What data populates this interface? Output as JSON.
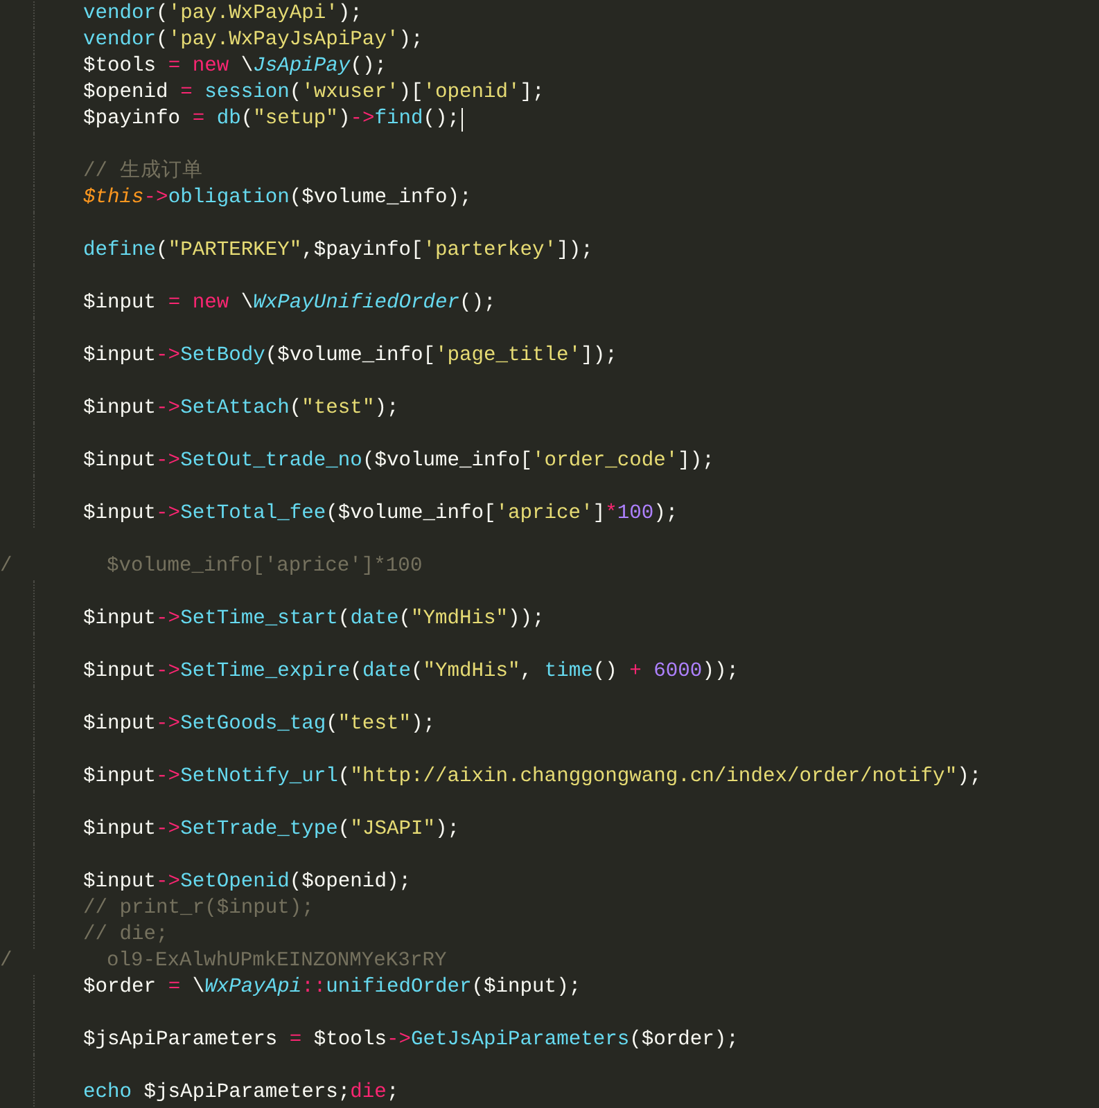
{
  "editor": {
    "lines": [
      {
        "kind": "code",
        "blank_before": false,
        "tokens": [
          {
            "kind": "fn",
            "text": "vendor"
          },
          {
            "kind": "plain",
            "text": "("
          },
          {
            "kind": "str",
            "text": "'pay.WxPayApi'"
          },
          {
            "kind": "plain",
            "text": ");"
          }
        ]
      },
      {
        "kind": "code",
        "blank_before": false,
        "tokens": [
          {
            "kind": "fn",
            "text": "vendor"
          },
          {
            "kind": "plain",
            "text": "("
          },
          {
            "kind": "str",
            "text": "'pay.WxPayJsApiPay'"
          },
          {
            "kind": "plain",
            "text": ");"
          }
        ]
      },
      {
        "kind": "code",
        "blank_before": false,
        "tokens": [
          {
            "kind": "plain",
            "text": "$tools "
          },
          {
            "kind": "kw",
            "text": "= new"
          },
          {
            "kind": "plain",
            "text": " \\"
          },
          {
            "kind": "cls",
            "text": "JsApiPay"
          },
          {
            "kind": "plain",
            "text": "();"
          }
        ]
      },
      {
        "kind": "code",
        "blank_before": false,
        "tokens": [
          {
            "kind": "plain",
            "text": "$openid "
          },
          {
            "kind": "kw",
            "text": "="
          },
          {
            "kind": "fn",
            "text": " session"
          },
          {
            "kind": "plain",
            "text": "("
          },
          {
            "kind": "str",
            "text": "'wxuser'"
          },
          {
            "kind": "plain",
            "text": ")["
          },
          {
            "kind": "str",
            "text": "'openid'"
          },
          {
            "kind": "plain",
            "text": "];"
          }
        ]
      },
      {
        "kind": "code",
        "blank_before": false,
        "cursor": true,
        "tokens": [
          {
            "kind": "plain",
            "text": "$payinfo "
          },
          {
            "kind": "kw",
            "text": "="
          },
          {
            "kind": "fn",
            "text": " db"
          },
          {
            "kind": "plain",
            "text": "("
          },
          {
            "kind": "str",
            "text": "\"setup\""
          },
          {
            "kind": "plain",
            "text": ")"
          },
          {
            "kind": "kw",
            "text": "->"
          },
          {
            "kind": "fn",
            "text": "find"
          },
          {
            "kind": "plain",
            "text": "();"
          }
        ]
      },
      {
        "kind": "code",
        "blank_before": true,
        "tokens": [
          {
            "kind": "comment",
            "text": "// 生成订单"
          }
        ]
      },
      {
        "kind": "code",
        "blank_before": false,
        "tokens": [
          {
            "kind": "this",
            "text": "$this"
          },
          {
            "kind": "kw",
            "text": "->"
          },
          {
            "kind": "fn",
            "text": "obligation"
          },
          {
            "kind": "plain",
            "text": "($volume_info);"
          }
        ]
      },
      {
        "kind": "code",
        "blank_before": true,
        "tokens": [
          {
            "kind": "fn",
            "text": "define"
          },
          {
            "kind": "plain",
            "text": "("
          },
          {
            "kind": "str",
            "text": "\"PARTERKEY\""
          },
          {
            "kind": "plain",
            "text": ",$payinfo["
          },
          {
            "kind": "str",
            "text": "'parterkey'"
          },
          {
            "kind": "plain",
            "text": "]);"
          }
        ]
      },
      {
        "kind": "code",
        "blank_before": true,
        "tokens": [
          {
            "kind": "plain",
            "text": "$input "
          },
          {
            "kind": "kw",
            "text": "= new"
          },
          {
            "kind": "plain",
            "text": " \\"
          },
          {
            "kind": "cls",
            "text": "WxPayUnifiedOrder"
          },
          {
            "kind": "plain",
            "text": "();"
          }
        ]
      },
      {
        "kind": "code",
        "blank_before": true,
        "tokens": [
          {
            "kind": "plain",
            "text": "$input"
          },
          {
            "kind": "kw",
            "text": "->"
          },
          {
            "kind": "fn",
            "text": "SetBody"
          },
          {
            "kind": "plain",
            "text": "($volume_info["
          },
          {
            "kind": "str",
            "text": "'page_title'"
          },
          {
            "kind": "plain",
            "text": "]);"
          }
        ]
      },
      {
        "kind": "code",
        "blank_before": true,
        "tokens": [
          {
            "kind": "plain",
            "text": "$input"
          },
          {
            "kind": "kw",
            "text": "->"
          },
          {
            "kind": "fn",
            "text": "SetAttach"
          },
          {
            "kind": "plain",
            "text": "("
          },
          {
            "kind": "str",
            "text": "\"test\""
          },
          {
            "kind": "plain",
            "text": ");"
          }
        ]
      },
      {
        "kind": "code",
        "blank_before": true,
        "tokens": [
          {
            "kind": "plain",
            "text": "$input"
          },
          {
            "kind": "kw",
            "text": "->"
          },
          {
            "kind": "fn",
            "text": "SetOut_trade_no"
          },
          {
            "kind": "plain",
            "text": "($volume_info["
          },
          {
            "kind": "str",
            "text": "'order_code'"
          },
          {
            "kind": "plain",
            "text": "]);"
          }
        ]
      },
      {
        "kind": "code",
        "blank_before": true,
        "tokens": [
          {
            "kind": "plain",
            "text": "$input"
          },
          {
            "kind": "kw",
            "text": "->"
          },
          {
            "kind": "fn",
            "text": "SetTotal_fee"
          },
          {
            "kind": "plain",
            "text": "($volume_info["
          },
          {
            "kind": "str",
            "text": "'aprice'"
          },
          {
            "kind": "plain",
            "text": "]"
          },
          {
            "kind": "kw",
            "text": "*"
          },
          {
            "kind": "num",
            "text": "100"
          },
          {
            "kind": "plain",
            "text": ");"
          }
        ]
      },
      {
        "kind": "stray",
        "marker": "/",
        "blank_before": true,
        "tokens": [
          {
            "kind": "comment",
            "text": "$volume_info['aprice']*100"
          }
        ]
      },
      {
        "kind": "code",
        "blank_before": true,
        "tokens": [
          {
            "kind": "plain",
            "text": "$input"
          },
          {
            "kind": "kw",
            "text": "->"
          },
          {
            "kind": "fn",
            "text": "SetTime_start"
          },
          {
            "kind": "plain",
            "text": "("
          },
          {
            "kind": "fn",
            "text": "date"
          },
          {
            "kind": "plain",
            "text": "("
          },
          {
            "kind": "str",
            "text": "\"YmdHis\""
          },
          {
            "kind": "plain",
            "text": "));"
          }
        ]
      },
      {
        "kind": "code",
        "blank_before": true,
        "tokens": [
          {
            "kind": "plain",
            "text": "$input"
          },
          {
            "kind": "kw",
            "text": "->"
          },
          {
            "kind": "fn",
            "text": "SetTime_expire"
          },
          {
            "kind": "plain",
            "text": "("
          },
          {
            "kind": "fn",
            "text": "date"
          },
          {
            "kind": "plain",
            "text": "("
          },
          {
            "kind": "str",
            "text": "\"YmdHis\""
          },
          {
            "kind": "plain",
            "text": ", "
          },
          {
            "kind": "fn",
            "text": "time"
          },
          {
            "kind": "plain",
            "text": "() "
          },
          {
            "kind": "kw",
            "text": "+"
          },
          {
            "kind": "num",
            "text": " 6000"
          },
          {
            "kind": "plain",
            "text": "));"
          }
        ]
      },
      {
        "kind": "code",
        "blank_before": true,
        "tokens": [
          {
            "kind": "plain",
            "text": "$input"
          },
          {
            "kind": "kw",
            "text": "->"
          },
          {
            "kind": "fn",
            "text": "SetGoods_tag"
          },
          {
            "kind": "plain",
            "text": "("
          },
          {
            "kind": "str",
            "text": "\"test\""
          },
          {
            "kind": "plain",
            "text": ");"
          }
        ]
      },
      {
        "kind": "code",
        "blank_before": true,
        "tokens": [
          {
            "kind": "plain",
            "text": "$input"
          },
          {
            "kind": "kw",
            "text": "->"
          },
          {
            "kind": "fn",
            "text": "SetNotify_url"
          },
          {
            "kind": "plain",
            "text": "("
          },
          {
            "kind": "str",
            "text": "\"http://aixin.changgongwang.cn/index/order/notify\""
          },
          {
            "kind": "plain",
            "text": ");"
          }
        ]
      },
      {
        "kind": "code",
        "blank_before": true,
        "tokens": [
          {
            "kind": "plain",
            "text": "$input"
          },
          {
            "kind": "kw",
            "text": "->"
          },
          {
            "kind": "fn",
            "text": "SetTrade_type"
          },
          {
            "kind": "plain",
            "text": "("
          },
          {
            "kind": "str",
            "text": "\"JSAPI\""
          },
          {
            "kind": "plain",
            "text": ");"
          }
        ]
      },
      {
        "kind": "code",
        "blank_before": true,
        "tokens": [
          {
            "kind": "plain",
            "text": "$input"
          },
          {
            "kind": "kw",
            "text": "->"
          },
          {
            "kind": "fn",
            "text": "SetOpenid"
          },
          {
            "kind": "plain",
            "text": "($openid);"
          }
        ]
      },
      {
        "kind": "code",
        "blank_before": false,
        "tokens": [
          {
            "kind": "comment",
            "text": "// print_r($input);"
          }
        ]
      },
      {
        "kind": "code",
        "blank_before": false,
        "tokens": [
          {
            "kind": "comment",
            "text": "// die;"
          }
        ]
      },
      {
        "kind": "stray",
        "marker": "/",
        "blank_before": false,
        "tokens": [
          {
            "kind": "comment",
            "text": "ol9-ExAlwhUPmkEINZONMYeK3rRY"
          }
        ]
      },
      {
        "kind": "code",
        "blank_before": false,
        "tokens": [
          {
            "kind": "plain",
            "text": "$order "
          },
          {
            "kind": "kw",
            "text": "="
          },
          {
            "kind": "plain",
            "text": " \\"
          },
          {
            "kind": "cls",
            "text": "WxPayApi"
          },
          {
            "kind": "kw",
            "text": "::"
          },
          {
            "kind": "fn",
            "text": "unifiedOrder"
          },
          {
            "kind": "plain",
            "text": "($input);"
          }
        ]
      },
      {
        "kind": "code",
        "blank_before": true,
        "tokens": [
          {
            "kind": "plain",
            "text": "$jsApiParameters "
          },
          {
            "kind": "kw",
            "text": "="
          },
          {
            "kind": "plain",
            "text": " $tools"
          },
          {
            "kind": "kw",
            "text": "->"
          },
          {
            "kind": "fn",
            "text": "GetJsApiParameters"
          },
          {
            "kind": "plain",
            "text": "($order);"
          }
        ]
      },
      {
        "kind": "code",
        "blank_before": true,
        "tokens": [
          {
            "kind": "fn",
            "text": "echo"
          },
          {
            "kind": "plain",
            "text": " $jsApiParameters;"
          },
          {
            "kind": "kw",
            "text": "die"
          },
          {
            "kind": "plain",
            "text": ";"
          }
        ]
      }
    ]
  }
}
